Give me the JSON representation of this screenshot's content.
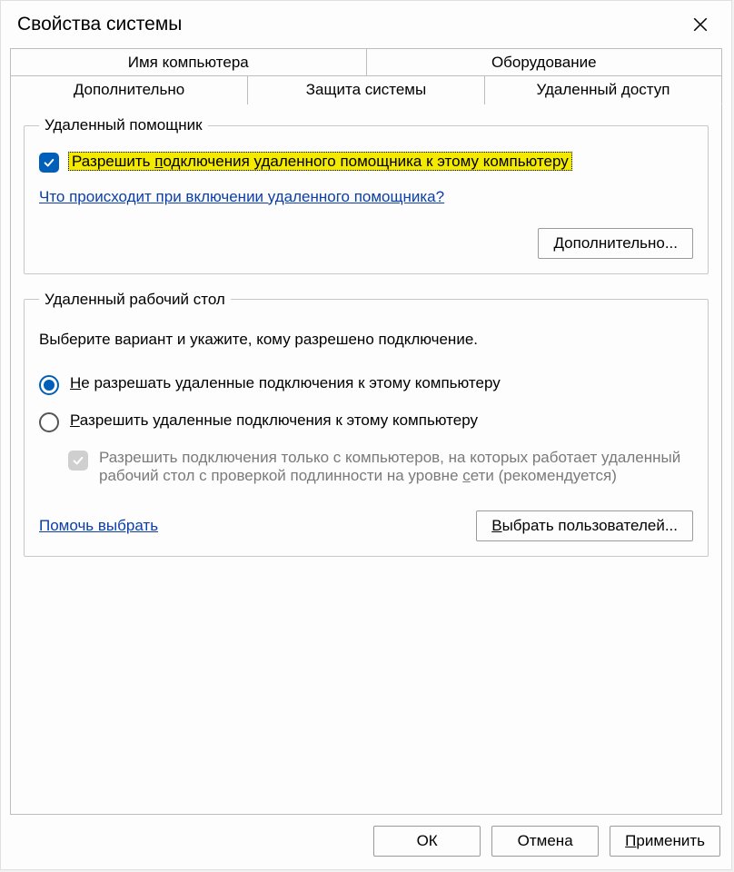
{
  "window": {
    "title": "Свойства системы"
  },
  "tabs": {
    "row1": [
      {
        "label": "Имя компьютера"
      },
      {
        "label": "Оборудование"
      }
    ],
    "row2": [
      {
        "label": "Дополнительно"
      },
      {
        "label": "Защита системы"
      },
      {
        "label": "Удаленный доступ",
        "active": true
      }
    ]
  },
  "remoteAssistance": {
    "legend": "Удаленный помощник",
    "allowLabelPart1": "Разрешить ",
    "allowLabelPart2_u": "п",
    "allowLabelPart3": "одключения удаленного помощника к этому компьютеру",
    "helpLink": "Что происходит при включении удаленного помощника?",
    "advancedBtn_pre_u": "Д",
    "advancedBtn_rest": "ополнительно..."
  },
  "remoteDesktop": {
    "legend": "Удаленный рабочий стол",
    "instruction": "Выберите вариант и укажите, кому разрешено подключение.",
    "optDeny_pre_u": "Н",
    "optDeny_rest": "е разрешать удаленные подключения к этому компьютеру",
    "optAllow_pre_u": "Р",
    "optAllow_rest": "азрешить удаленные подключения к этому компьютеру",
    "nlaLabelPart1": "Разрешить подключения только с компьютеров, на которых работает удаленный рабочий стол с проверкой подлинности на уровне ",
    "nlaLabel_u": "с",
    "nlaLabelPart3": "ети (рекомендуется)",
    "helpLinkPart1": "Помочь ",
    "helpLink_u": "в",
    "helpLinkPart3": "ыбрать",
    "selectUsers_pre_u": "В",
    "selectUsers_rest": "ыбрать пользователей..."
  },
  "buttons": {
    "ok": "ОК",
    "cancel": "Отмена",
    "apply_pre_u": "П",
    "apply_rest": "рименить"
  }
}
